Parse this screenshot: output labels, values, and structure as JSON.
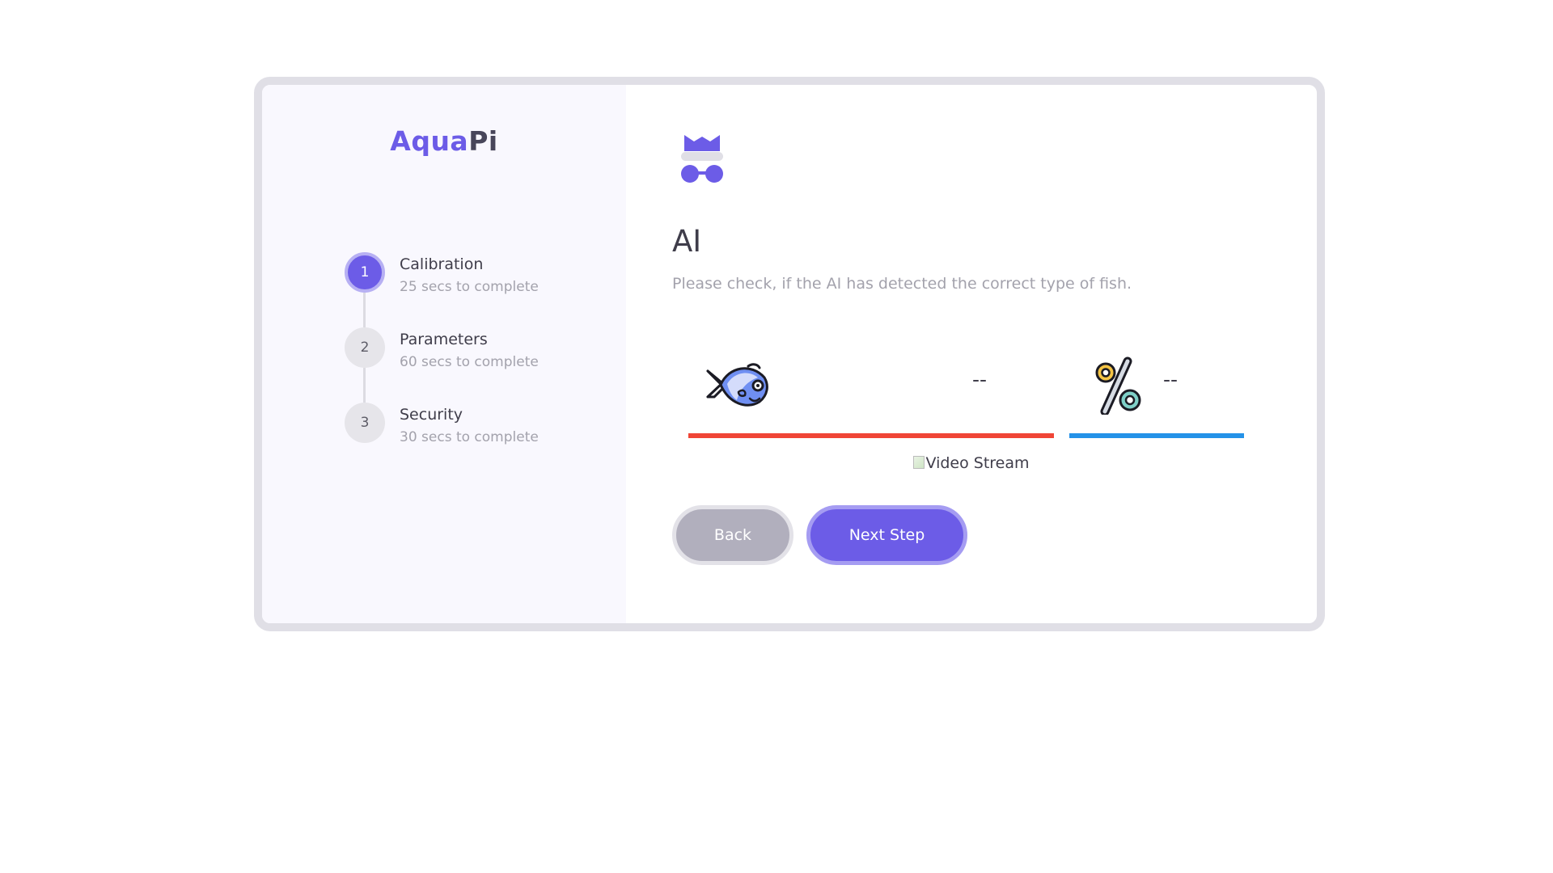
{
  "brand": {
    "part1": "Aqua",
    "part2": "Pi"
  },
  "steps": [
    {
      "number": "1",
      "title": "Calibration",
      "subtitle": "25 secs to complete",
      "active": true
    },
    {
      "number": "2",
      "title": "Parameters",
      "subtitle": "60 secs to complete",
      "active": false
    },
    {
      "number": "3",
      "title": "Security",
      "subtitle": "30 secs to complete",
      "active": false
    }
  ],
  "main": {
    "icon": "spy-icon",
    "title": "AI",
    "description": "Please check, if the AI has detected the correct type of fish.",
    "fish": {
      "icon": "fish-icon",
      "value": "--"
    },
    "confidence": {
      "icon": "percent-icon",
      "value": "--"
    },
    "video": {
      "icon": "broken-image-icon",
      "alt": "Video Stream"
    }
  },
  "buttons": {
    "back": "Back",
    "next": "Next Step"
  },
  "colors": {
    "accent": "#6c5ce7",
    "bar_fish": "#f04536",
    "bar_confidence": "#2492e8",
    "sidebar_bg": "#f9f8fe"
  }
}
